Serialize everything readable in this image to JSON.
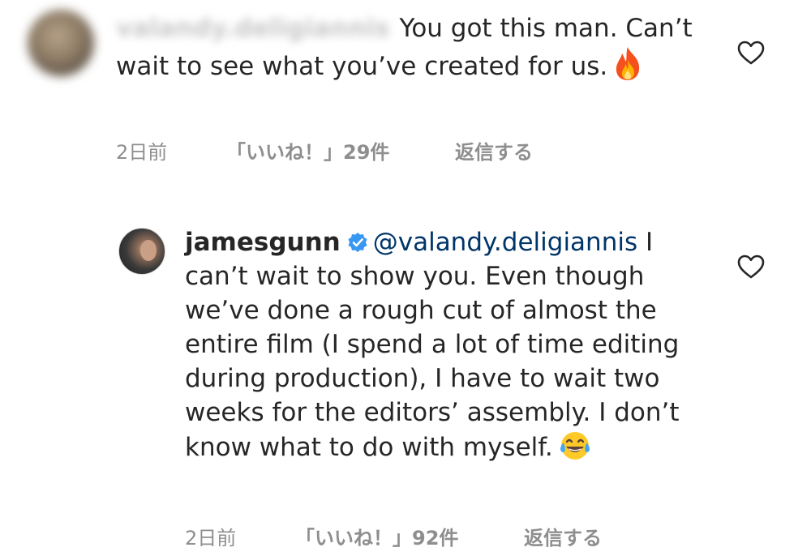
{
  "comments": [
    {
      "username_blurred": "valandy.deligiannis",
      "text": "You got this man. Can’t wait to see what you’ve created for us.",
      "emoji_icon": "fire-emoji-icon",
      "time": "2日前",
      "likes": "「いいね！」29件",
      "reply": "返信する"
    },
    {
      "username": "jamesgunn",
      "verified_icon": "verified-badge-icon",
      "mention": "@valandy.deligiannis",
      "text": "I can’t wait to show you. Even though we’ve done a rough cut of almost the entire film (I spend a lot of time editing during production), I have to wait two weeks for the editors’ assembly. I don’t know what to do with myself.",
      "emoji_icon": "tears-of-joy-emoji-icon",
      "time": "2日前",
      "likes": "「いいね！」92件",
      "reply": "返信する"
    }
  ],
  "colors": {
    "text": "#262626",
    "meta": "#8e8e8e",
    "mention": "#003569",
    "verified": "#3897f0"
  }
}
